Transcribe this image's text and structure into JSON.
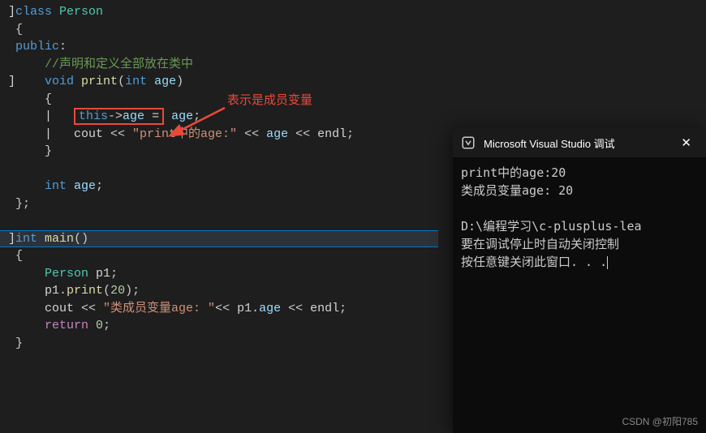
{
  "code": {
    "l1_class": "class",
    "l1_type": "Person",
    "l2_brace": "{",
    "l3_public": "public",
    "l3_colon": ":",
    "l4_comment": "//声明和定义全部放在类中",
    "l5_void": "void",
    "l5_fn": "print",
    "l5_lp": "(",
    "l5_int": "int",
    "l5_param": "age",
    "l5_rp": ")",
    "l6_brace": "{",
    "l7_this": "this",
    "l7_arrow": "->",
    "l7_member": "age",
    "l7_eq": " = ",
    "l7_rhs": "age",
    "l7_semi": ";",
    "l8_cout": "cout",
    "l8_op1": " << ",
    "l8_str": "\"print中的age:\"",
    "l8_op2": " << ",
    "l8_var": "age",
    "l8_op3": " << ",
    "l8_endl": "endl",
    "l8_semi": ";",
    "l9_brace": "}",
    "l11_int": "int",
    "l11_member": "age",
    "l11_semi": ";",
    "l12_close": "};",
    "l14_int": "int",
    "l14_main": "main",
    "l14_paren": "()",
    "l15_brace": "{",
    "l16_type": "Person",
    "l16_var": "p1",
    "l16_semi": ";",
    "l17_obj": "p1",
    "l17_dot": ".",
    "l17_fn": "print",
    "l17_lp": "(",
    "l17_arg": "20",
    "l17_rp": ")",
    "l17_semi": ";",
    "l18_cout": "cout",
    "l18_op1": " << ",
    "l18_str": "\"类成员变量age: \"",
    "l18_op2": "<< ",
    "l18_obj": "p1",
    "l18_dot": ".",
    "l18_member": "age",
    "l18_op3": " << ",
    "l18_endl": "endl",
    "l18_semi": ";",
    "l19_return": "return",
    "l19_val": "0",
    "l19_semi": ";",
    "l20_brace": "}"
  },
  "annotation": {
    "text": "表示是成员变量"
  },
  "console": {
    "title": "Microsoft Visual Studio 调试",
    "line1": "print中的age:20",
    "line2": "类成员变量age: 20",
    "line3": "",
    "line4": "D:\\编程学习\\c-plusplus-lea",
    "line5": "要在调试停止时自动关闭控制",
    "line6": "按任意键关闭此窗口. . ."
  },
  "watermark": "CSDN @初阳785"
}
